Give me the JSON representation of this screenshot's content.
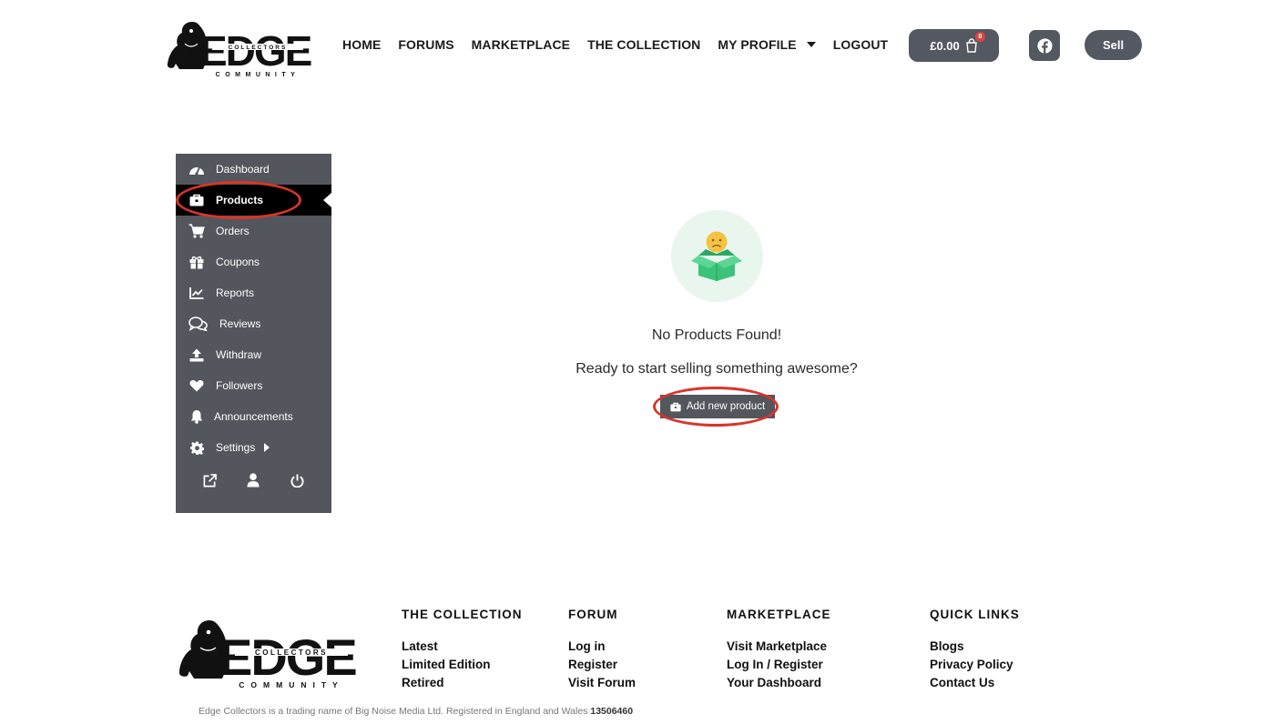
{
  "brand": {
    "logo_main": "EDGE",
    "logo_band": "COLLECTORS",
    "logo_sub": "COMMUNITY"
  },
  "header": {
    "nav": [
      {
        "label": "HOME"
      },
      {
        "label": "FORUMS"
      },
      {
        "label": "MARKETPLACE"
      },
      {
        "label": "THE COLLECTION"
      },
      {
        "label": "MY PROFILE",
        "dropdown": true
      },
      {
        "label": "LOGOUT"
      }
    ],
    "cart": {
      "total": "£0.00",
      "count": "0"
    },
    "sell_label": "Sell",
    "icons": {
      "cart": "shopping-bag-icon",
      "social": "facebook-icon"
    }
  },
  "sidebar": {
    "items": [
      {
        "label": "Dashboard",
        "icon": "gauge-icon"
      },
      {
        "label": "Products",
        "icon": "briefcase-icon",
        "active": true
      },
      {
        "label": "Orders",
        "icon": "cart-icon"
      },
      {
        "label": "Coupons",
        "icon": "gift-icon"
      },
      {
        "label": "Reports",
        "icon": "chart-icon"
      },
      {
        "label": "Reviews",
        "icon": "comments-icon"
      },
      {
        "label": "Withdraw",
        "icon": "upload-icon"
      },
      {
        "label": "Followers",
        "icon": "heart-icon"
      },
      {
        "label": "Announcements",
        "icon": "bell-icon"
      },
      {
        "label": "Settings",
        "icon": "gear-icon",
        "submenu": true
      }
    ],
    "bottom_icons": [
      "external-link-icon",
      "user-icon",
      "power-icon"
    ]
  },
  "main": {
    "empty_title": "No Products Found!",
    "empty_subtitle": "Ready to start selling something awesome?",
    "add_button": "Add new product",
    "empty_icon": "sad-box-icon"
  },
  "footer": {
    "columns": [
      {
        "heading": "THE COLLECTION",
        "links": [
          "Latest",
          "Limited Edition",
          "Retired"
        ]
      },
      {
        "heading": "FORUM",
        "links": [
          "Log in",
          "Register",
          "Visit Forum"
        ]
      },
      {
        "heading": "MARKETPLACE",
        "links": [
          "Visit Marketplace",
          "Log In / Register",
          "Your Dashboard"
        ]
      },
      {
        "heading": "QUICK LINKS",
        "links": [
          "Blogs",
          "Privacy Policy",
          "Contact Us"
        ]
      }
    ],
    "copyright_text": "Edge Collectors is a trading name of Big Noise Media Ltd. Registered in England and Wales",
    "company_number": "13506460"
  },
  "colors": {
    "sidebar_bg": "#53565c",
    "active_bg": "#000000",
    "button_bg": "#545861",
    "highlight": "#d8352a",
    "empty_circle": "#e8f6ee",
    "box_green": "#3cc37a",
    "badge_red": "#d64545"
  }
}
